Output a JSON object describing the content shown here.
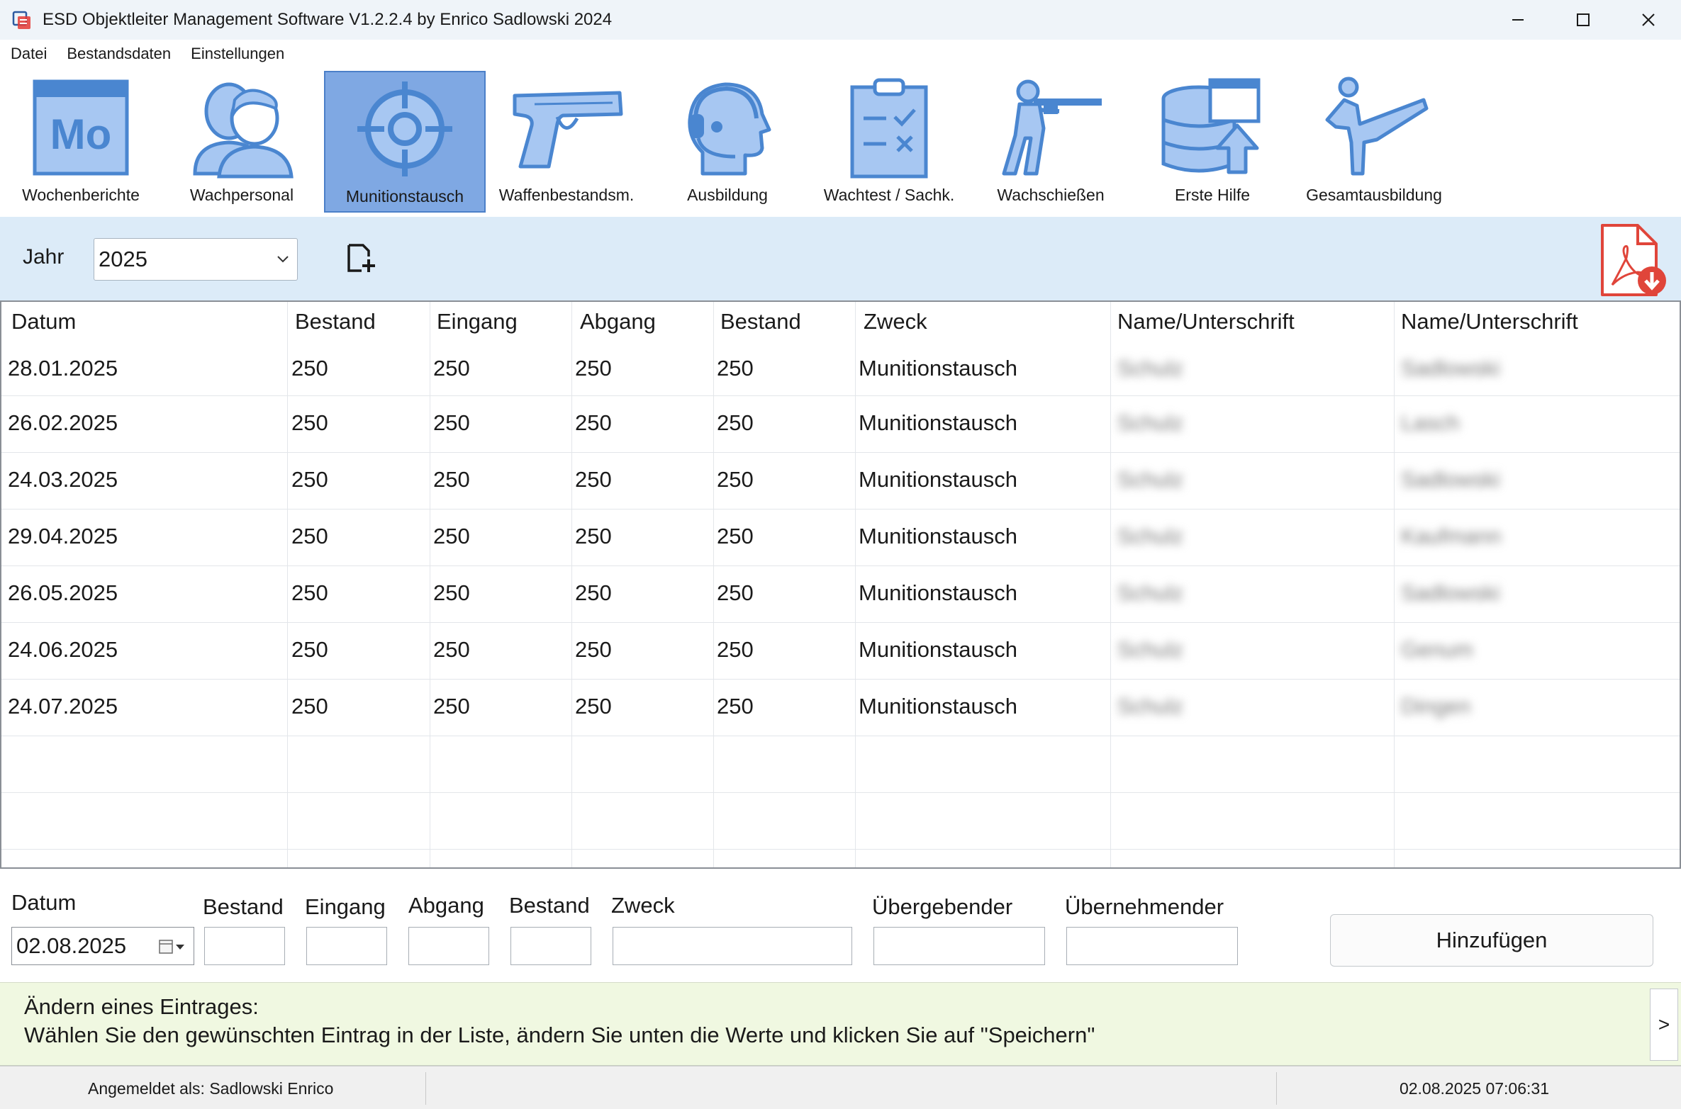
{
  "window": {
    "title": "ESD Objektleiter Management Software V1.2.2.4 by Enrico Sadlowski 2024"
  },
  "menu": [
    "Datei",
    "Bestandsdaten",
    "Einstellungen"
  ],
  "toolbar": {
    "active_index": 2,
    "items": [
      {
        "label": "Wochenberichte",
        "icon": "calendar-mo-icon",
        "mo": "Mo"
      },
      {
        "label": "Wachpersonal",
        "icon": "people-icon"
      },
      {
        "label": "Munitionstausch",
        "icon": "target-icon"
      },
      {
        "label": "Waffenbestandsm.",
        "icon": "pistol-icon"
      },
      {
        "label": "Ausbildung",
        "icon": "headset-icon"
      },
      {
        "label": "Wachtest / Sachk.",
        "icon": "clipboard-check-icon"
      },
      {
        "label": "Wachschießen",
        "icon": "shooter-icon"
      },
      {
        "label": "Erste Hilfe",
        "icon": "database-upload-icon"
      },
      {
        "label": "Gesamtausbildung",
        "icon": "kick-icon"
      }
    ]
  },
  "filter": {
    "year_label": "Jahr",
    "year_value": "2025"
  },
  "table": {
    "headers": [
      "Datum",
      "Bestand",
      "Eingang",
      "Abgang",
      "Bestand",
      "Zweck",
      "Name/Unterschrift",
      "Name/Unterschrift"
    ],
    "rows": [
      [
        "28.01.2025",
        "250",
        "250",
        "250",
        "250",
        "Munitionstausch",
        "Schulz",
        "Sadlowski"
      ],
      [
        "26.02.2025",
        "250",
        "250",
        "250",
        "250",
        "Munitionstausch",
        "Schulz",
        "Lasch"
      ],
      [
        "24.03.2025",
        "250",
        "250",
        "250",
        "250",
        "Munitionstausch",
        "Schulz",
        "Sadlowski"
      ],
      [
        "29.04.2025",
        "250",
        "250",
        "250",
        "250",
        "Munitionstausch",
        "Schulz",
        "Kaufmann"
      ],
      [
        "26.05.2025",
        "250",
        "250",
        "250",
        "250",
        "Munitionstausch",
        "Schulz",
        "Sadlowski"
      ],
      [
        "24.06.2025",
        "250",
        "250",
        "250",
        "250",
        "Munitionstausch",
        "Schulz",
        "Genum"
      ],
      [
        "24.07.2025",
        "250",
        "250",
        "250",
        "250",
        "Munitionstausch",
        "Schulz",
        "Dingen"
      ]
    ]
  },
  "form": {
    "labels": {
      "datum": "Datum",
      "bestand1": "Bestand",
      "eingang": "Eingang",
      "abgang": "Abgang",
      "bestand2": "Bestand",
      "zweck": "Zweck",
      "uebergebender": "Übergebender",
      "uebernehmender": "Übernehmender"
    },
    "date_value": "02.08.2025",
    "add_button": "Hinzufügen"
  },
  "info": {
    "title": "Ändern eines Eintrages:",
    "text": "Wählen Sie den gewünschten Eintrag in der Liste, ändern Sie unten die Werte und klicken Sie auf \"Speichern\"",
    "toggle": ">"
  },
  "status": {
    "user": "Angemeldet als: Sadlowski Enrico",
    "datetime": "02.08.2025 07:06:31"
  },
  "colors": {
    "accent": "#7fa8e3",
    "icon_fill": "#a7c7f2",
    "icon_stroke": "#4a86d0",
    "filter_bg": "#dcebf8",
    "info_bg": "#f0f8e1",
    "pdf_red": "#e0453a"
  }
}
